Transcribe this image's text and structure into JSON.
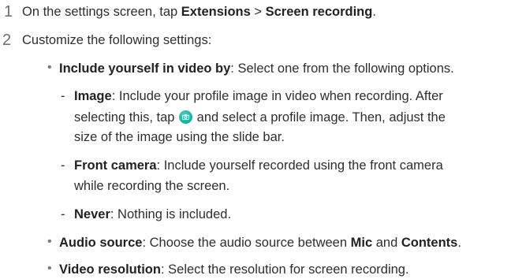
{
  "steps": [
    {
      "number": "1",
      "text_pre": "On the settings screen, tap ",
      "bold_a": "Extensions",
      "sep": " > ",
      "bold_b": "Screen recording",
      "text_post": "."
    },
    {
      "number": "2",
      "text": "Customize the following settings:"
    }
  ],
  "include_yourself": {
    "term": "Include yourself in video by",
    "desc": ": Select one from the following options."
  },
  "options": {
    "image": {
      "term": "Image",
      "line1": ": Include your profile image in video when recording. After",
      "line2_pre": "selecting this, tap ",
      "line2_post": " and select a profile image. Then, adjust the",
      "line3": "size of the image using the slide bar."
    },
    "front_camera": {
      "term": "Front camera",
      "line1": ": Include yourself recorded using the front camera",
      "line2": "while recording the screen."
    },
    "never": {
      "term": "Never",
      "desc": ": Nothing is included."
    }
  },
  "audio_source": {
    "term": "Audio source",
    "desc_pre": ": Choose the audio source between ",
    "opt_a": "Mic",
    "and": " and ",
    "opt_b": "Contents",
    "end": "."
  },
  "video_resolution": {
    "term": "Video resolution",
    "desc": ": Select the resolution for screen recording."
  },
  "icons": {
    "bullet": "•",
    "dash": "-",
    "camera_icon": "camera-icon"
  },
  "colors": {
    "icon_teal": "#1fb39f"
  }
}
